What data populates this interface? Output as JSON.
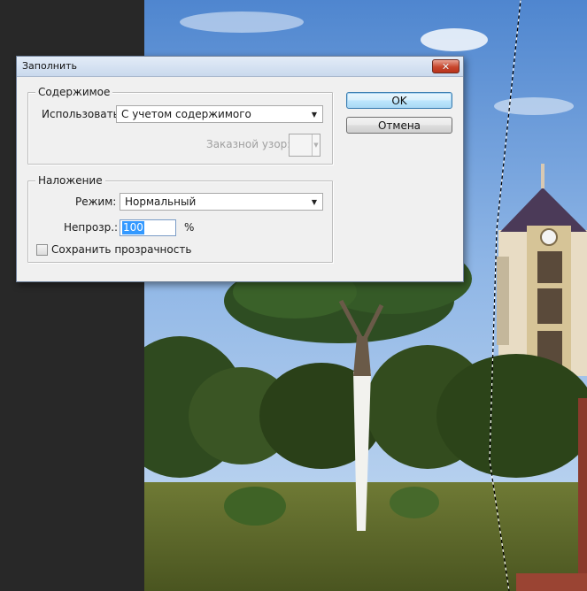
{
  "dialog": {
    "title": "Заполнить",
    "close_label": "✕"
  },
  "contents_group": {
    "title": "Содержимое",
    "use_label": "Использовать:",
    "use_value": "С учетом содержимого",
    "custom_pattern_label": "Заказной узор:"
  },
  "blending_group": {
    "title": "Наложение",
    "mode_label": "Режим:",
    "mode_value": "Нормальный",
    "opacity_label": "Непрозр.:",
    "opacity_value": "100",
    "opacity_unit": "%",
    "preserve_transparency_label": "Сохранить прозрачность",
    "preserve_transparency_checked": false
  },
  "buttons": {
    "ok": "OK",
    "cancel": "Отмена"
  },
  "icons": {
    "dropdown": "chevron-down-icon",
    "close": "close-icon"
  },
  "colors": {
    "dialog_bg": "#f0f0f0",
    "close_button": "#c8472d",
    "selection": "#3399ff"
  }
}
